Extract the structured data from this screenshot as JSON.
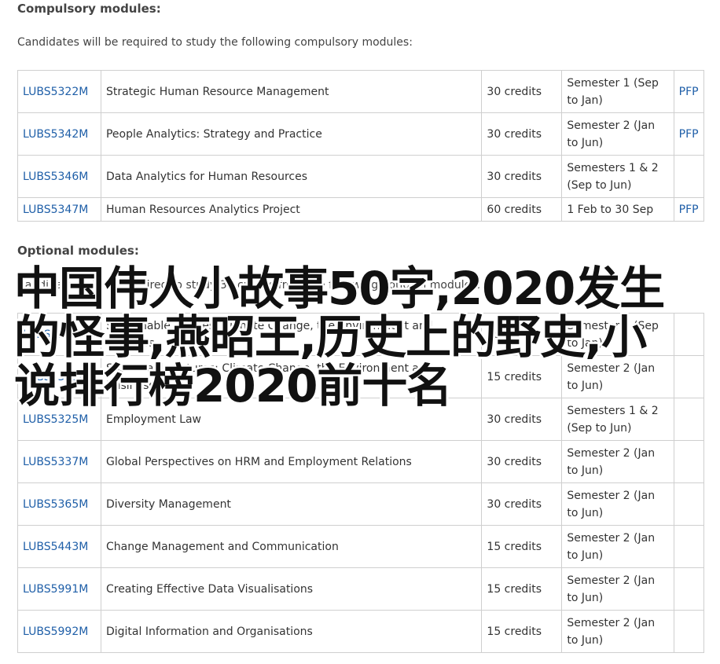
{
  "compulsory": {
    "heading": "Compulsory modules:",
    "intro": "Candidates will be required to study the following compulsory modules:",
    "rows": [
      {
        "code": "LUBS5322M",
        "title": "Strategic Human Resource Management",
        "credits": "30 credits",
        "semester": "Semester 1 (Sep to Jan)",
        "pfp": "PFP"
      },
      {
        "code": "LUBS5342M",
        "title": "People Analytics: Strategy and Practice",
        "credits": "30 credits",
        "semester": "Semester 2 (Jan to Jun)",
        "pfp": "PFP"
      },
      {
        "code": "LUBS5346M",
        "title": "Data Analytics for Human Resources",
        "credits": "30 credits",
        "semester": "Semesters 1 & 2 (Sep to Jun)",
        "pfp": ""
      },
      {
        "code": "LUBS5347M",
        "title": "Human Resources Analytics Project",
        "credits": "60 credits",
        "semester": "1 Feb to 30 Sep",
        "pfp": "PFP"
      }
    ]
  },
  "optional": {
    "heading": "Optional modules:",
    "intro": "Candidates will be required to study 30 credits from the following optional modules:",
    "rows": [
      {
        "code": "LUBS5304M",
        "title": "Sustainable Futures: Climate Change, the Environment and Business",
        "credits": "15 credits",
        "semester": "Semester 1 (Sep to Jan)",
        "pfp": ""
      },
      {
        "code": "LUBS5305M",
        "title": "Sustainable Futures: Climate Change, the Environment and Business",
        "credits": "15 credits",
        "semester": "Semester 2 (Jan to Jun)",
        "pfp": ""
      },
      {
        "code": "LUBS5325M",
        "title": "Employment Law",
        "credits": "30 credits",
        "semester": "Semesters 1 & 2 (Sep to Jun)",
        "pfp": ""
      },
      {
        "code": "LUBS5337M",
        "title": "Global Perspectives on HRM and Employment Relations",
        "credits": "30 credits",
        "semester": "Semester 2 (Jan to Jun)",
        "pfp": ""
      },
      {
        "code": "LUBS5365M",
        "title": "Diversity Management",
        "credits": "30 credits",
        "semester": "Semester 2 (Jan to Jun)",
        "pfp": ""
      },
      {
        "code": "LUBS5443M",
        "title": "Change Management and Communication",
        "credits": "15 credits",
        "semester": "Semester 2 (Jan to Jun)",
        "pfp": ""
      },
      {
        "code": "LUBS5991M",
        "title": "Creating Effective Data Visualisations",
        "credits": "15 credits",
        "semester": "Semester 2 (Jan to Jun)",
        "pfp": ""
      },
      {
        "code": "LUBS5992M",
        "title": "Digital Information and Organisations",
        "credits": "15 credits",
        "semester": "Semester 2 (Jan to Jun)",
        "pfp": ""
      }
    ]
  },
  "overlay": {
    "text": "中国伟人小故事50字,2020发生的怪事,燕昭王,历史上的野史,小说排行榜2020前十名"
  }
}
